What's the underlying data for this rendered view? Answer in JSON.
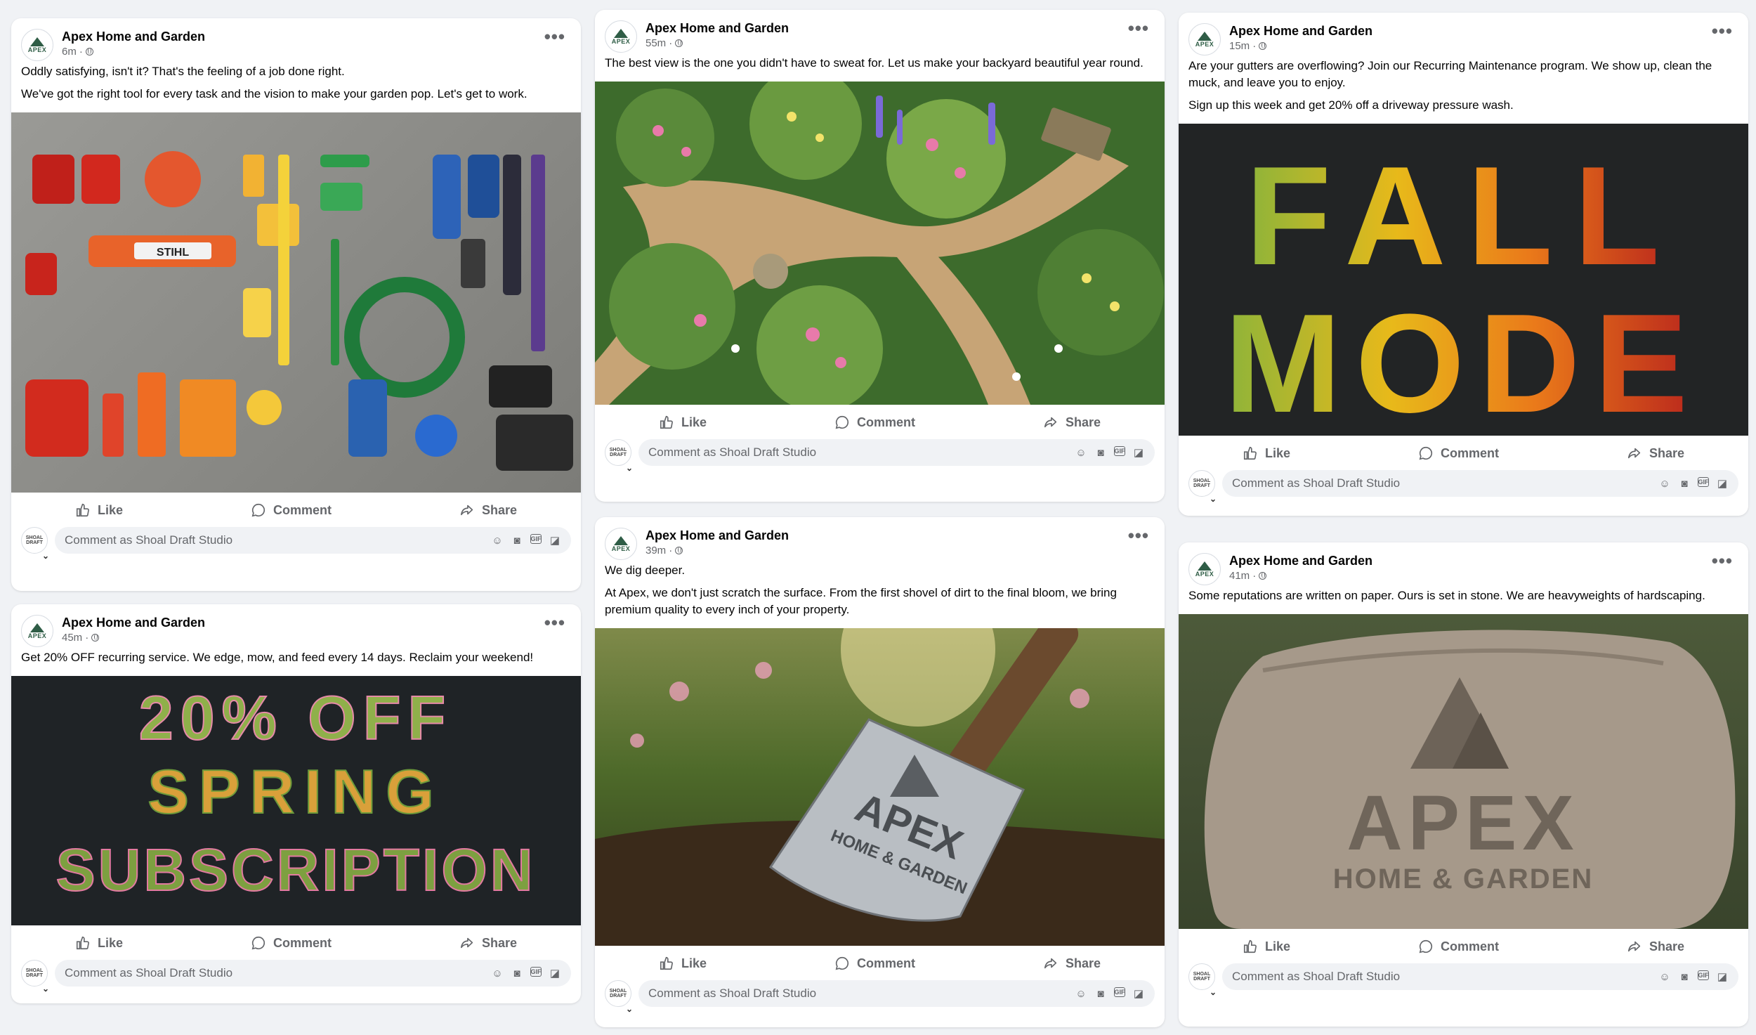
{
  "page_name": "Apex Home and Garden",
  "commenter_placeholder": "Comment as Shoal Draft Studio",
  "commenter_avatar_text": "SHOAL DRAFT",
  "avatar_logo_text": "APEX",
  "actions": {
    "like": "Like",
    "comment": "Comment",
    "share": "Share"
  },
  "posts": [
    {
      "time": "6m",
      "paragraphs": [
        "Oddly satisfying, isn't it? That's the feeling of a job done right.",
        "We've got the right tool for every task and the vision to make your garden pop. Let's get to work."
      ],
      "image_desc": "tools",
      "image_text": "STIHL"
    },
    {
      "time": "45m",
      "paragraphs": [
        "Get 20% OFF recurring service. We edge, mow, and feed every 14 days. Reclaim your weekend!"
      ],
      "image_desc": "leaf-letters",
      "image_text": [
        "20% OFF",
        "SPRING",
        "SUBSCRIPTION"
      ]
    },
    {
      "time": "55m",
      "paragraphs": [
        "The best view is the one you didn't have to sweat for. Let us make your backyard beautiful year round."
      ],
      "image_desc": "garden-path"
    },
    {
      "time": "39m",
      "paragraphs": [
        "We dig deeper.",
        "At Apex, we don't just scratch the surface. From the first shovel of dirt to the final bloom, we bring premium quality to every inch of your property."
      ],
      "image_desc": "shovel",
      "image_text": [
        "APEX",
        "HOME & GARDEN"
      ]
    },
    {
      "time": "15m",
      "paragraphs": [
        "Are your gutters are overflowing? Join our Recurring Maintenance program. We show up, clean the muck, and leave you to enjoy.",
        "Sign up this week and get 20% off a driveway pressure wash."
      ],
      "image_desc": "fall-mode",
      "image_text": [
        "FALL",
        "MODE"
      ]
    },
    {
      "time": "41m",
      "paragraphs": [
        "Some reputations are written on paper. Ours is set in stone. We are heavyweights of hardscaping."
      ],
      "image_desc": "stone",
      "image_text": [
        "APEX",
        "HOME & GARDEN"
      ]
    }
  ],
  "colors": {
    "bg": "#f0f2f5",
    "muted": "#65676b",
    "brand": "#2f5d46"
  }
}
